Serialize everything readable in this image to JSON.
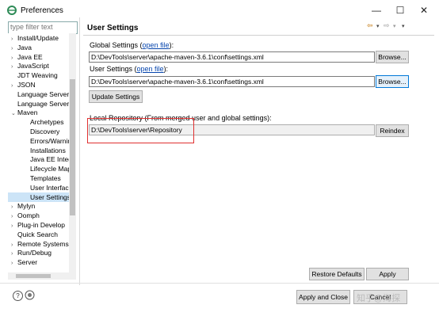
{
  "window": {
    "title": "Preferences",
    "minimize": "—",
    "maximize": "☐",
    "close": "✕"
  },
  "sidebar": {
    "filter_placeholder": "type filter text",
    "items": [
      {
        "label": "Install/Update",
        "arrow": "›",
        "indent": 0
      },
      {
        "label": "Java",
        "arrow": "›",
        "indent": 0
      },
      {
        "label": "Java EE",
        "arrow": "›",
        "indent": 0
      },
      {
        "label": "JavaScript",
        "arrow": "›",
        "indent": 0
      },
      {
        "label": "JDT Weaving",
        "arrow": "",
        "indent": 0
      },
      {
        "label": "JSON",
        "arrow": "›",
        "indent": 0
      },
      {
        "label": "Language Server",
        "arrow": "",
        "indent": 0
      },
      {
        "label": "Language Server",
        "arrow": "",
        "indent": 0
      },
      {
        "label": "Maven",
        "arrow": "⌄",
        "indent": 0
      },
      {
        "label": "Archetypes",
        "arrow": "",
        "indent": 1
      },
      {
        "label": "Discovery",
        "arrow": "",
        "indent": 1
      },
      {
        "label": "Errors/Warnin",
        "arrow": "",
        "indent": 1
      },
      {
        "label": "Installations",
        "arrow": "",
        "indent": 1
      },
      {
        "label": "Java EE Integra",
        "arrow": "",
        "indent": 1
      },
      {
        "label": "Lifecycle Map",
        "arrow": "",
        "indent": 1
      },
      {
        "label": "Templates",
        "arrow": "",
        "indent": 1
      },
      {
        "label": "User Interface",
        "arrow": "",
        "indent": 1
      },
      {
        "label": "User Settings",
        "arrow": "",
        "indent": 1,
        "selected": true
      },
      {
        "label": "Mylyn",
        "arrow": "›",
        "indent": 0
      },
      {
        "label": "Oomph",
        "arrow": "›",
        "indent": 0
      },
      {
        "label": "Plug-in Develop",
        "arrow": "›",
        "indent": 0
      },
      {
        "label": "Quick Search",
        "arrow": "",
        "indent": 0
      },
      {
        "label": "Remote Systems",
        "arrow": "›",
        "indent": 0
      },
      {
        "label": "Run/Debug",
        "arrow": "›",
        "indent": 0
      },
      {
        "label": "Server",
        "arrow": "›",
        "indent": 0
      }
    ]
  },
  "page": {
    "title": "User Settings",
    "nav_back": "⇦",
    "nav_menu": "▾",
    "nav_forward": "⇨",
    "global_label": "Global Settings (",
    "global_link": "open file",
    "global_label_end": "):",
    "global_value": "D:\\DevTools\\server\\apache-maven-3.6.1\\conf\\settings.xml",
    "browse1": "Browse...",
    "user_label": "User Settings (",
    "user_link": "open file",
    "user_label_end": "):",
    "user_value": "D:\\DevTools\\server\\apache-maven-3.6.1\\conf\\settings.xml",
    "browse2": "Browse...",
    "update": "Update Settings",
    "local_label": "Local Repository (From merged user and global settings):",
    "local_value": "D:\\DevTools\\server\\Repository",
    "reindex": "Reindex",
    "restore": "Restore Defaults",
    "apply": "Apply"
  },
  "footer": {
    "help": "?",
    "apply_close": "Apply and Close",
    "cancel": "Cancel",
    "watermark": "知乎@海探"
  }
}
